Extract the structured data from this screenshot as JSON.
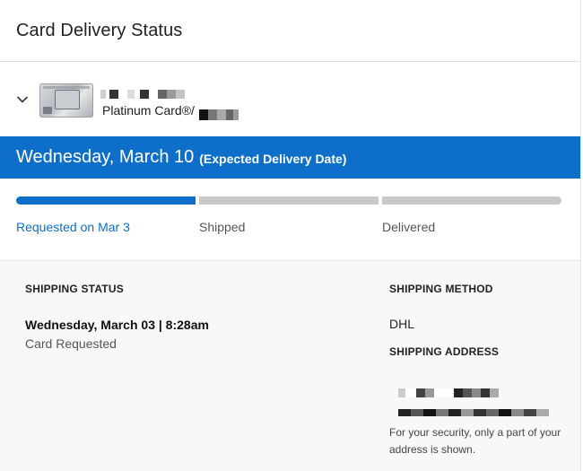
{
  "header": {
    "title": "Card Delivery Status"
  },
  "card": {
    "name": "Platinum Card®",
    "name_suffix": "/"
  },
  "delivery": {
    "date": "Wednesday, March 10",
    "note": "(Expected Delivery Date)"
  },
  "progress": {
    "steps": [
      {
        "label": "Requested on Mar 3",
        "state": "complete"
      },
      {
        "label": "Shipped",
        "state": "pending"
      },
      {
        "label": "Delivered",
        "state": "pending"
      }
    ],
    "completed_steps": 1,
    "total_steps": 3
  },
  "shipping_status": {
    "heading": "SHIPPING STATUS",
    "timestamp": "Wednesday, March 03 | 8:28am",
    "description": "Card Requested"
  },
  "shipping_method": {
    "heading": "SHIPPING METHOD",
    "value": "DHL"
  },
  "shipping_address": {
    "heading": "SHIPPING ADDRESS",
    "security_note": "For your security, only a part of your address is shown."
  },
  "colors": {
    "accent": "#0d6fca",
    "progress_pending": "#c8c8c8",
    "details_bg": "#f7f8f9"
  },
  "icons": {
    "expand": "chevron-down-icon",
    "card": "card-image"
  }
}
